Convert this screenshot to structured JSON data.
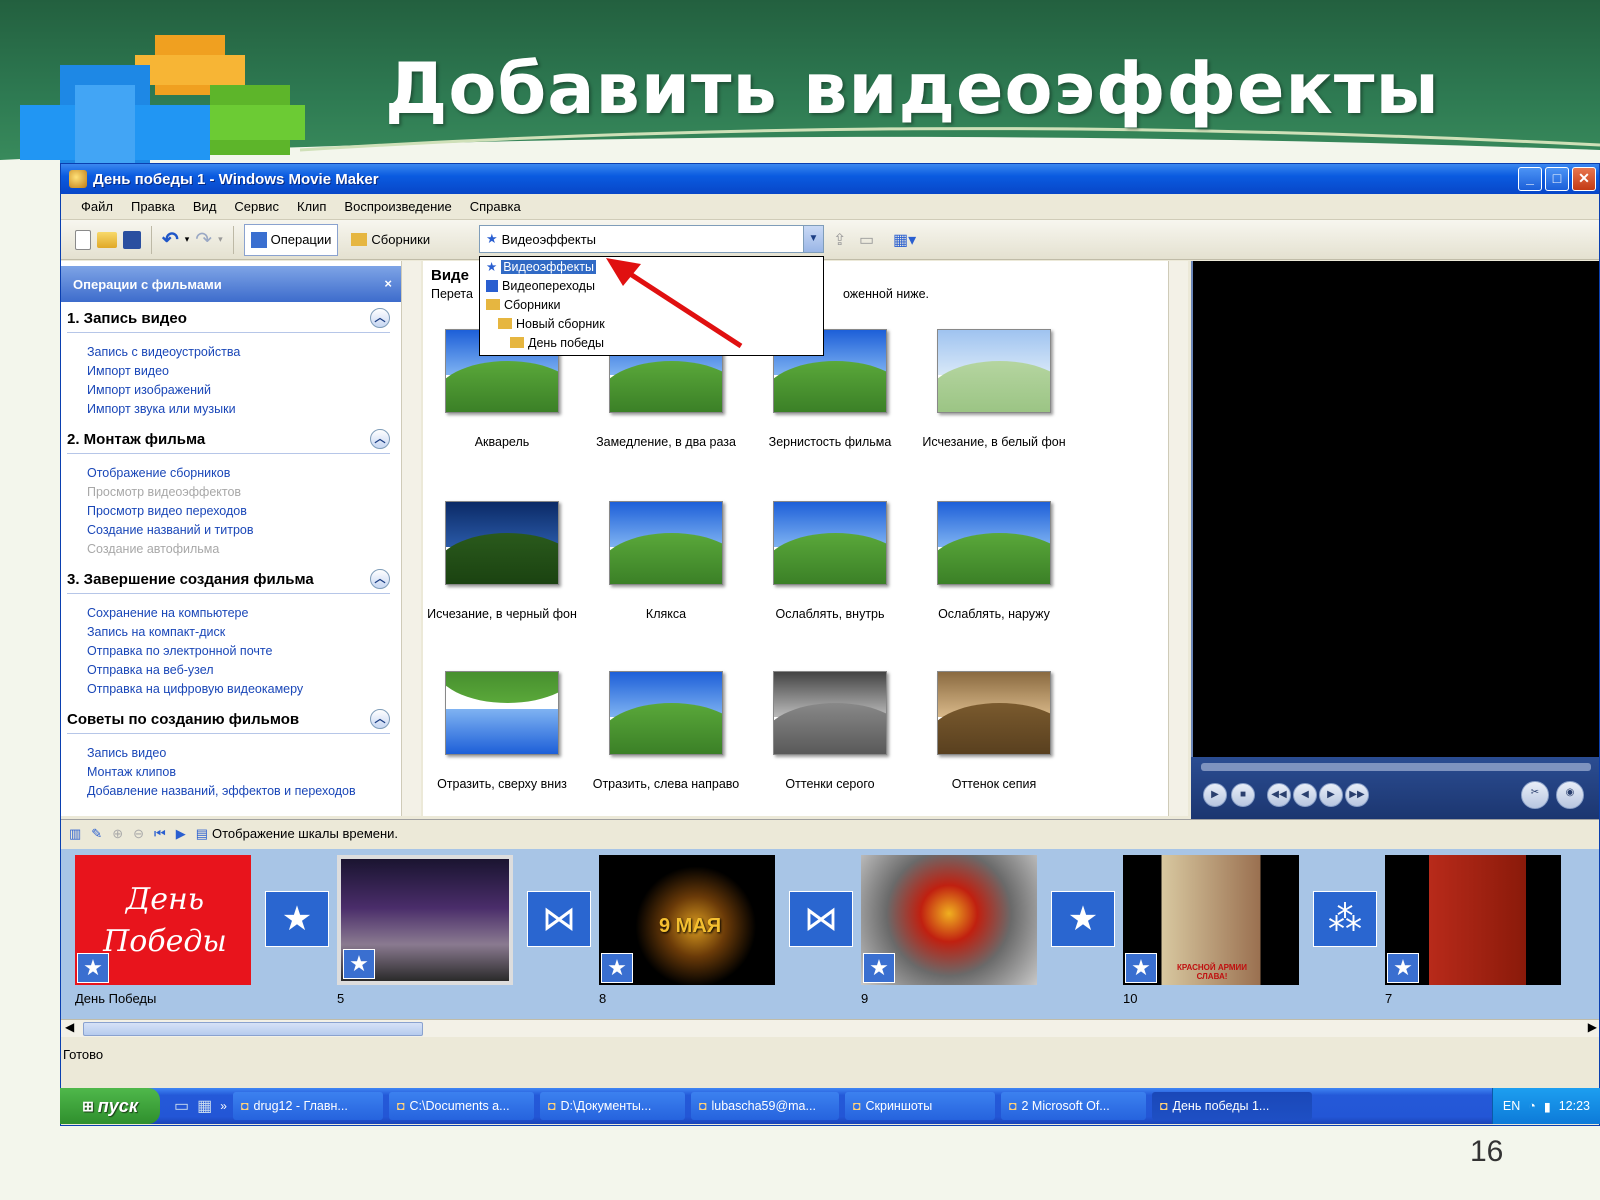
{
  "slide": {
    "title": "Добавить видеоэффекты",
    "number": "16"
  },
  "window": {
    "title": "День победы 1 - Windows Movie Maker",
    "controls": {
      "minimize": "_",
      "maximize": "□",
      "close": "✕"
    }
  },
  "menu": [
    "Файл",
    "Правка",
    "Вид",
    "Сервис",
    "Клип",
    "Воспроизведение",
    "Справка"
  ],
  "toolbar": {
    "operations_label": "Операции",
    "collections_label": "Сборники",
    "dropdown_value": "Видеоэффекты"
  },
  "dropdown_list": [
    {
      "label": "Видеоэффекты",
      "level": 0,
      "selected": true
    },
    {
      "label": "Видеопереходы",
      "level": 0,
      "selected": false
    },
    {
      "label": "Сборники",
      "level": 0,
      "selected": false
    },
    {
      "label": "Новый сборник",
      "level": 1,
      "selected": false
    },
    {
      "label": "День победы",
      "level": 2,
      "selected": false
    }
  ],
  "taskpane": {
    "header": "Операции с фильмами",
    "close": "×",
    "sections": [
      {
        "title": "1. Запись видео",
        "links": [
          {
            "label": "Запись с видеоустройства",
            "disabled": false
          },
          {
            "label": "Импорт видео",
            "disabled": false
          },
          {
            "label": "Импорт изображений",
            "disabled": false
          },
          {
            "label": "Импорт звука или музыки",
            "disabled": false
          }
        ]
      },
      {
        "title": "2. Монтаж фильма",
        "links": [
          {
            "label": "Отображение сборников",
            "disabled": false
          },
          {
            "label": "Просмотр видеоэффектов",
            "disabled": true
          },
          {
            "label": "Просмотр видео переходов",
            "disabled": false
          },
          {
            "label": "Создание названий и титров",
            "disabled": false
          },
          {
            "label": "Создание автофильма",
            "disabled": true
          }
        ]
      },
      {
        "title": "3. Завершение создания фильма",
        "links": [
          {
            "label": "Сохранение на компьютере",
            "disabled": false
          },
          {
            "label": "Запись на компакт-диск",
            "disabled": false
          },
          {
            "label": "Отправка по электронной почте",
            "disabled": false
          },
          {
            "label": "Отправка на веб-узел",
            "disabled": false
          },
          {
            "label": "Отправка на цифровую видеокамеру",
            "disabled": false
          }
        ]
      },
      {
        "title": "Советы по созданию фильмов",
        "links": [
          {
            "label": "Запись видео",
            "disabled": false
          },
          {
            "label": "Монтаж клипов",
            "disabled": false
          },
          {
            "label": "Добавление названий, эффектов и переходов",
            "disabled": false
          }
        ]
      }
    ]
  },
  "gallery": {
    "title": "Виде",
    "hint_start": "Перета",
    "hint_end": "оженной ниже.",
    "effects": [
      {
        "label": "Акварель",
        "style": "normal"
      },
      {
        "label": "Замедление, в два раза",
        "style": "normal"
      },
      {
        "label": "Зернистость фильма",
        "style": "normal"
      },
      {
        "label": "Исчезание, в белый фон",
        "style": "white"
      },
      {
        "label": "Исчезание, в черный фон",
        "style": "dark"
      },
      {
        "label": "Клякса",
        "style": "normal"
      },
      {
        "label": "Ослаблять, внутрь",
        "style": "normal"
      },
      {
        "label": "Ослаблять, наружу",
        "style": "normal"
      },
      {
        "label": "Отразить, сверху вниз",
        "style": "flip"
      },
      {
        "label": "Отразить, слева направо",
        "style": "normal"
      },
      {
        "label": "Оттенки серого",
        "style": "gray"
      },
      {
        "label": "Оттенок сепия",
        "style": "sepia"
      }
    ]
  },
  "storyboard": {
    "toolbar_label": "Отображение шкалы времени.",
    "clips": [
      {
        "label": "День Победы",
        "text": "День Победы",
        "kind": "red"
      },
      {
        "label": "5",
        "kind": "castle"
      },
      {
        "label": "8",
        "text": "9 МАЯ",
        "kind": "may9"
      },
      {
        "label": "9",
        "kind": "star"
      },
      {
        "label": "10",
        "text": "КРАСНОЙ АРМИИ СЛАВА!",
        "kind": "poster"
      },
      {
        "label": "7",
        "kind": "monument"
      }
    ]
  },
  "status": "Готово",
  "taskbar": {
    "start": "пуск",
    "tasks": [
      {
        "label": "drug12 - Главн...",
        "active": false
      },
      {
        "label": "C:\\Documents a...",
        "active": false
      },
      {
        "label": "D:\\Документы...",
        "active": false
      },
      {
        "label": "lubascha59@ma...",
        "active": false
      },
      {
        "label": "Скриншоты",
        "active": false
      },
      {
        "label": "2 Microsoft Of...",
        "active": false
      },
      {
        "label": "День победы 1...",
        "active": true
      }
    ],
    "lang": "EN",
    "clock": "12:23"
  }
}
